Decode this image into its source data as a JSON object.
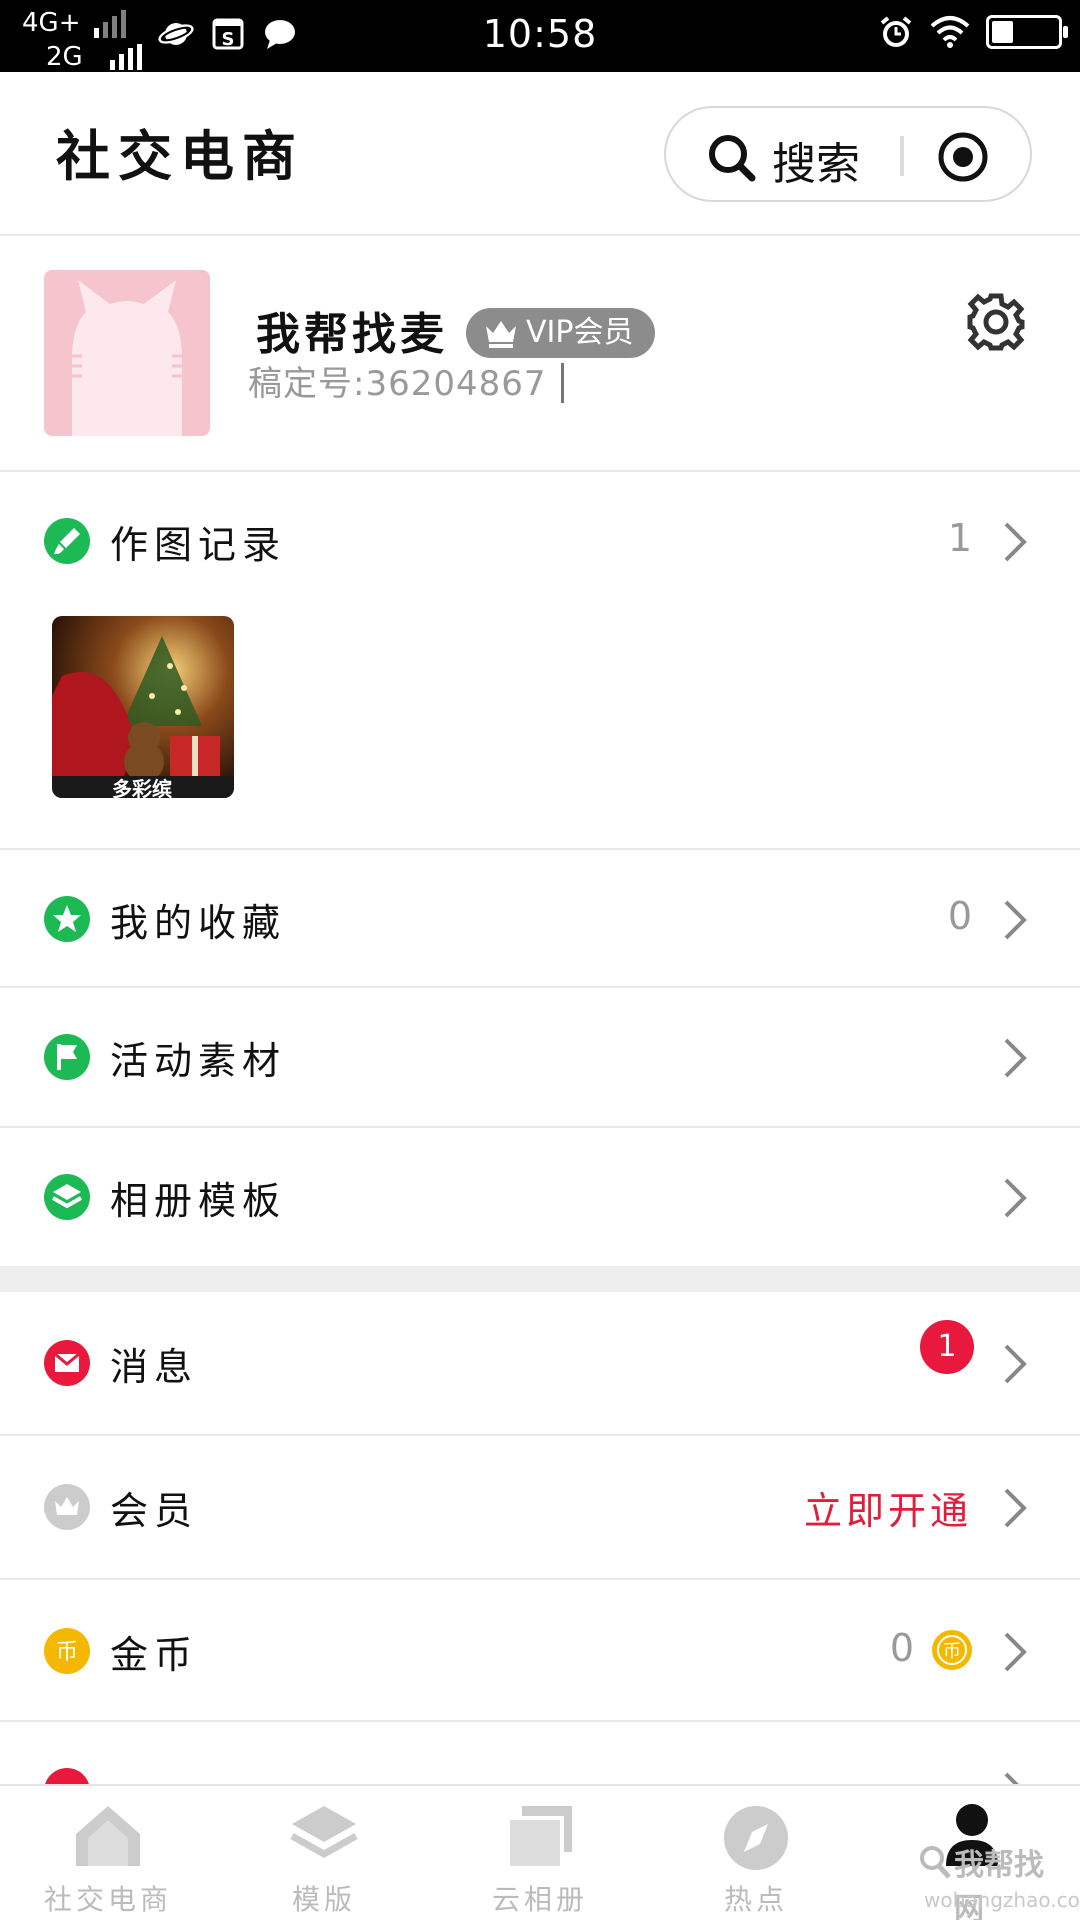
{
  "status_bar": {
    "network_top": "4G+",
    "network_bottom": "2G",
    "time": "10:58"
  },
  "header": {
    "title": "社交电商",
    "search_label": "搜索"
  },
  "profile": {
    "nickname": "我帮找麦",
    "vip_label": "VIP会员",
    "account_id": "稿定号:36204867"
  },
  "rows": {
    "drawing_records": {
      "label": "作图记录",
      "count": "1"
    },
    "favorites": {
      "label": "我的收藏",
      "count": "0"
    },
    "activity_materials": {
      "label": "活动素材"
    },
    "album_templates": {
      "label": "相册模板"
    },
    "messages": {
      "label": "消息",
      "badge": "1"
    },
    "membership": {
      "label": "会员",
      "action": "立即开通"
    },
    "coins": {
      "label": "金币",
      "count": "0",
      "coin_symbol": "币"
    }
  },
  "tabs": [
    {
      "label": "社交电商",
      "icon": "home-icon"
    },
    {
      "label": "模版",
      "icon": "layers-icon"
    },
    {
      "label": "云相册",
      "icon": "album-icon"
    },
    {
      "label": "热点",
      "icon": "compass-icon"
    },
    {
      "label": "",
      "icon": "profile-icon"
    }
  ],
  "watermark": {
    "name": "我帮找网",
    "url": "wobangzhao.com"
  },
  "colors": {
    "accent_green": "#1db954",
    "accent_red": "#e8193c",
    "coin_yellow": "#f5b800",
    "vip_gray": "#8c8c8c",
    "avatar_pink": "#f5c4cc"
  }
}
